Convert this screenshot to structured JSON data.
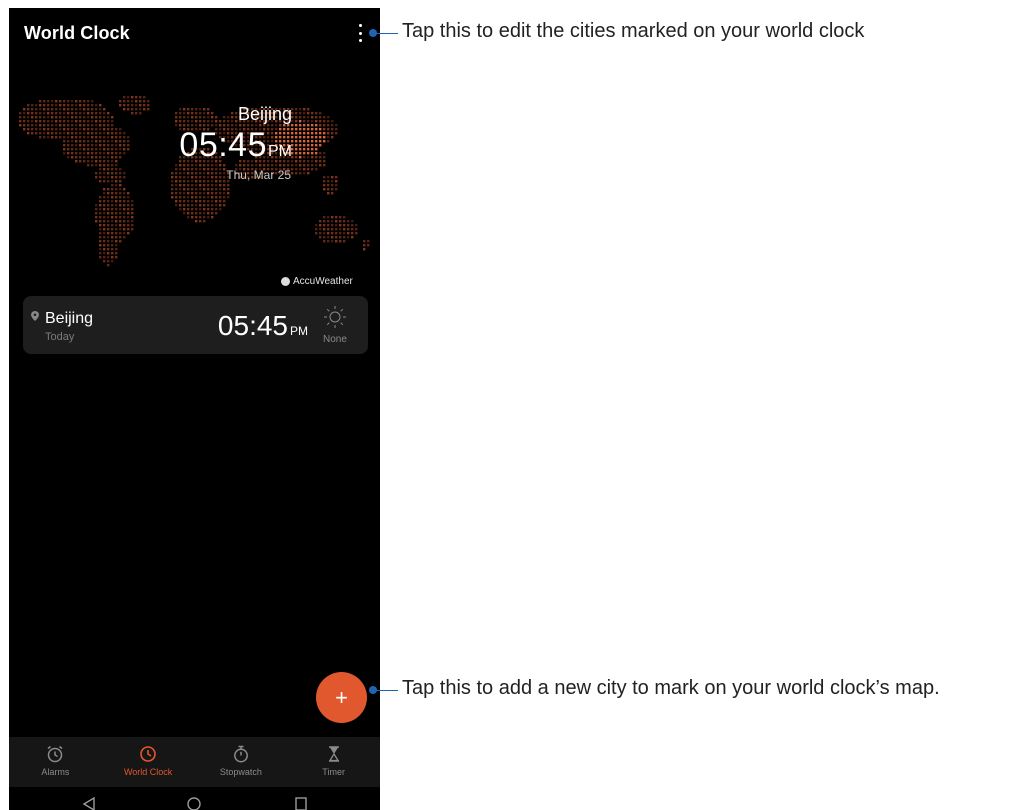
{
  "app": {
    "title": "World Clock"
  },
  "map": {
    "city": "Beijing",
    "time": "05:45",
    "ampm": "PM",
    "date": "Thu, Mar 25",
    "credit": "AccuWeather",
    "dot_color": "#c0502c"
  },
  "cities": [
    {
      "name": "Beijing",
      "day": "Today",
      "time": "05:45",
      "ampm": "PM",
      "weather": "None"
    }
  ],
  "fab": {
    "icon": "plus-icon",
    "label": "+"
  },
  "bottom_nav": {
    "items": [
      {
        "label": "Alarms",
        "icon": "alarm-icon",
        "active": false
      },
      {
        "label": "World Clock",
        "icon": "clock-icon",
        "active": true
      },
      {
        "label": "Stopwatch",
        "icon": "stopwatch-icon",
        "active": false
      },
      {
        "label": "Timer",
        "icon": "hourglass-icon",
        "active": false
      }
    ]
  },
  "system_nav": [
    "back-icon",
    "home-icon",
    "recents-icon"
  ],
  "callouts": [
    {
      "text": "Tap this to edit the cities marked on your world clock"
    },
    {
      "text": "Tap this to add a new city to mark on your world clock’s map."
    }
  ],
  "colors": {
    "accent": "#e1582f",
    "callout": "#1f63b5",
    "background": "#000000",
    "card": "#1e1e1e"
  }
}
